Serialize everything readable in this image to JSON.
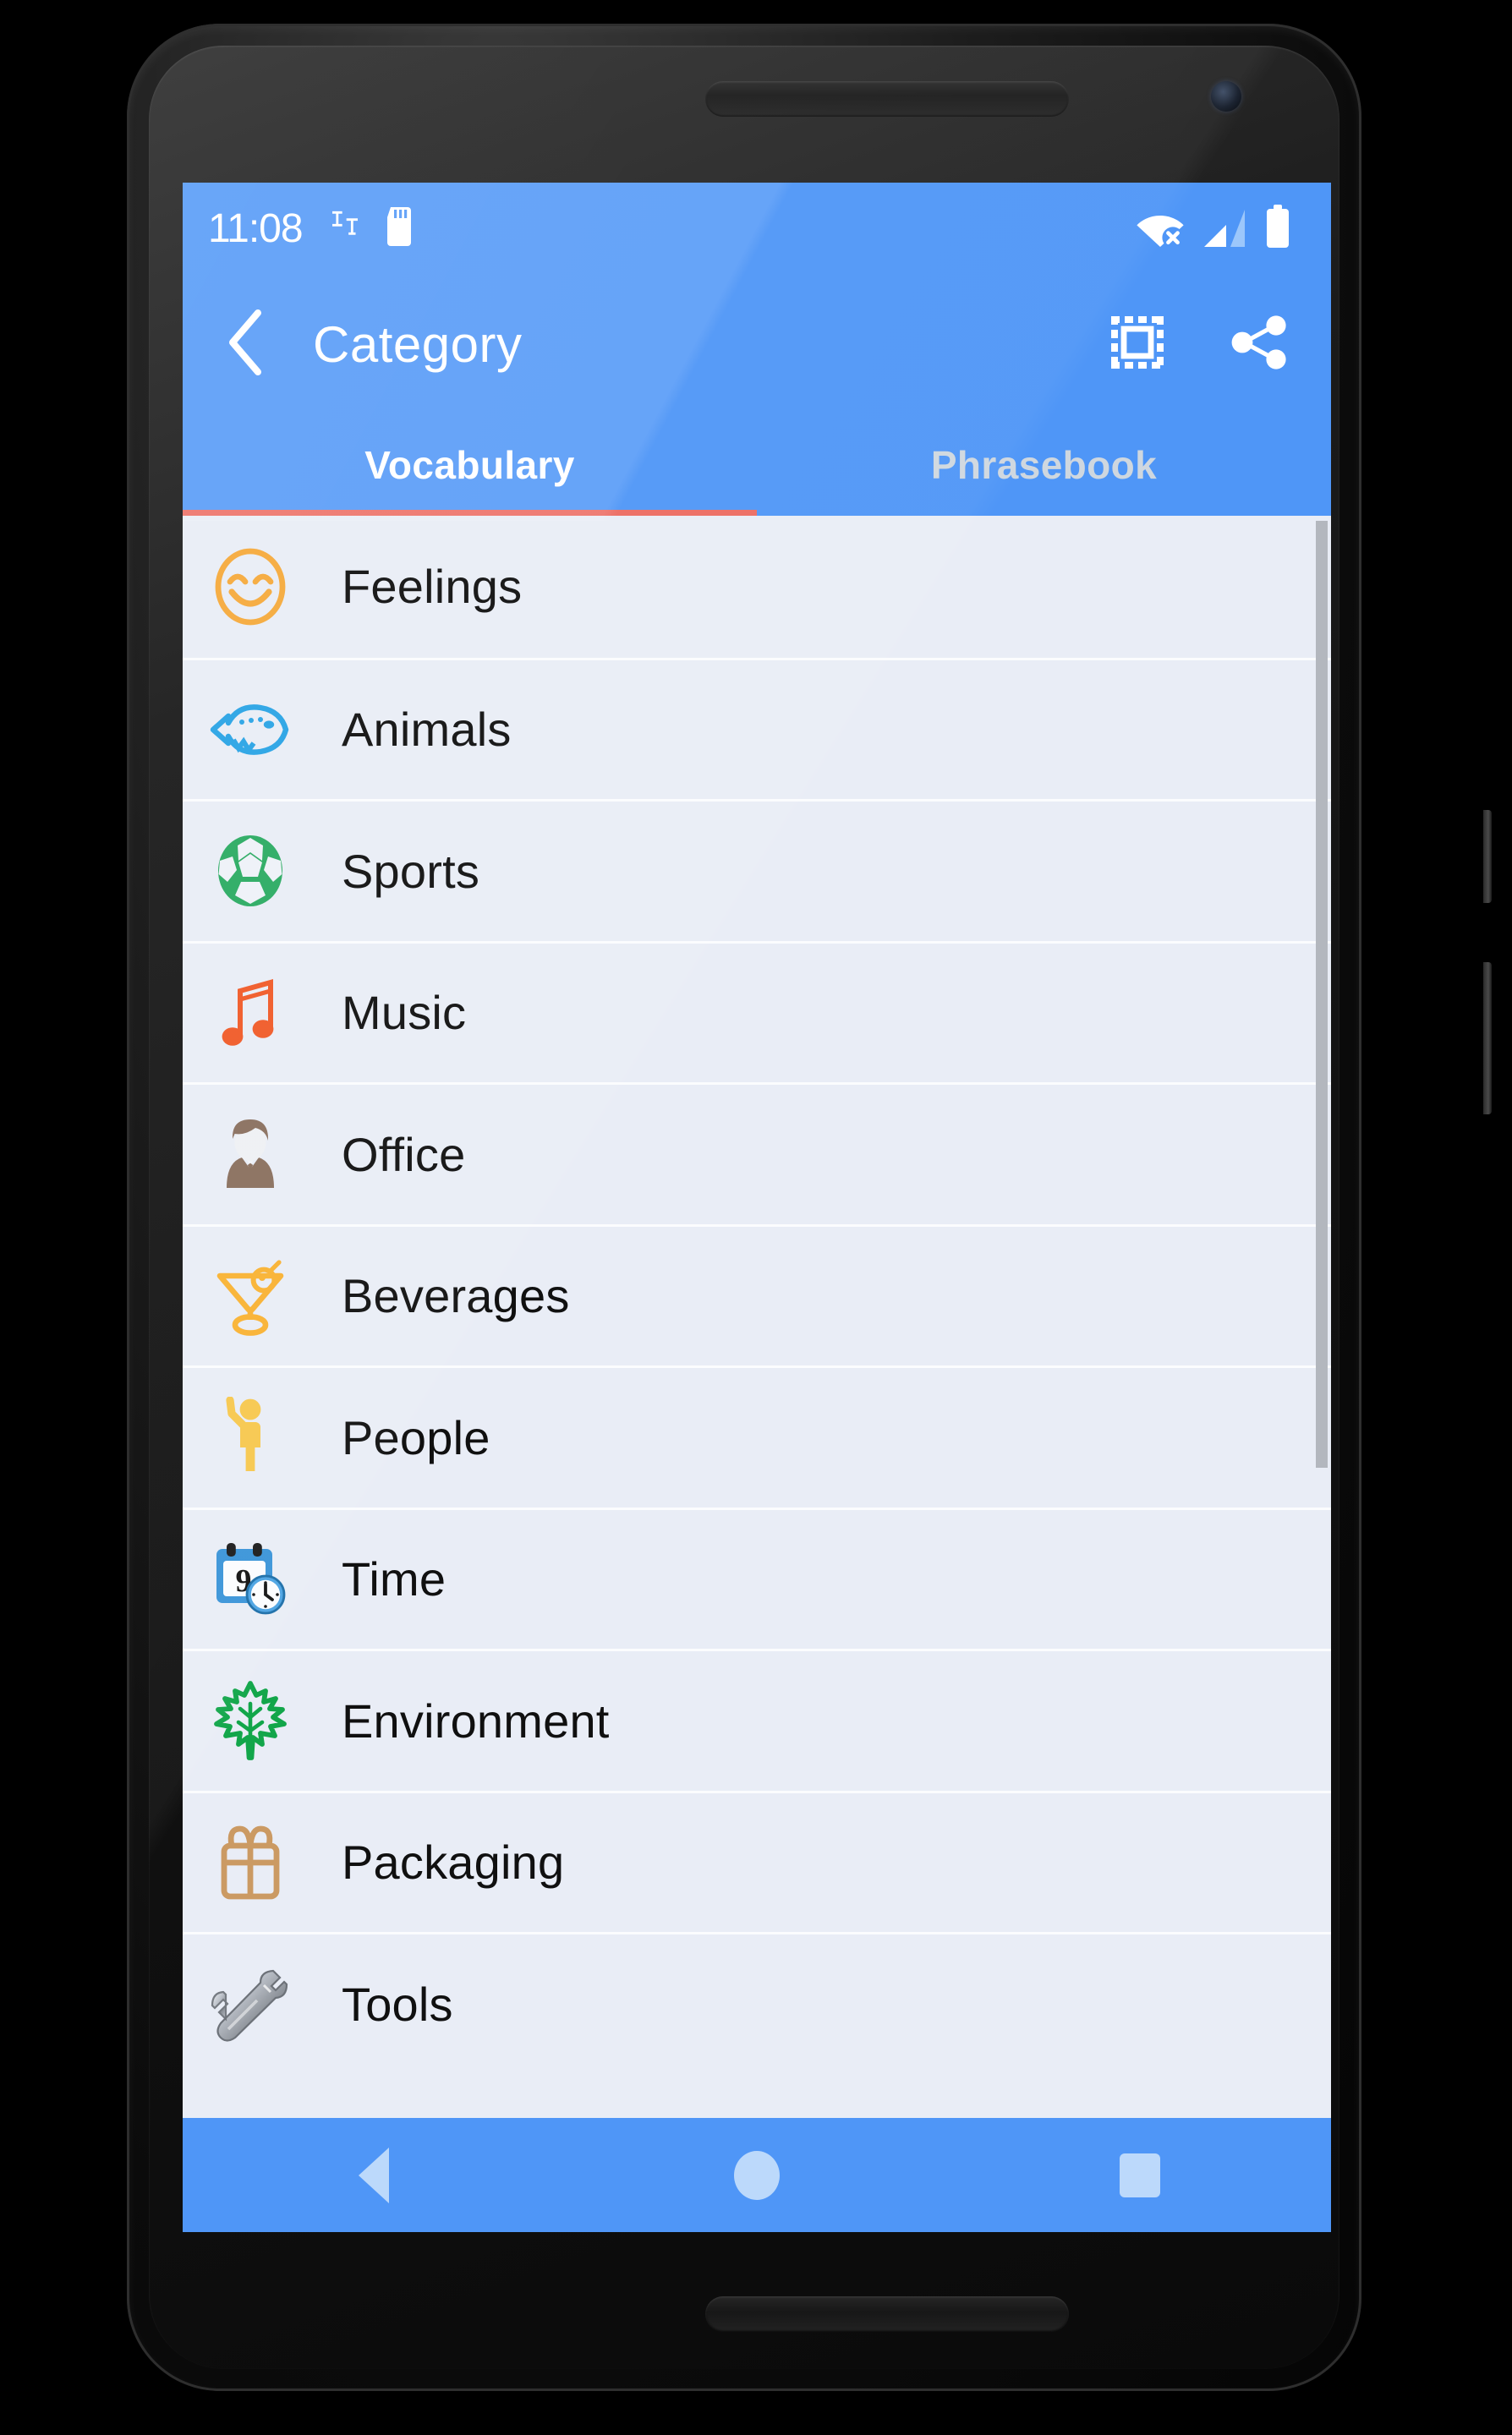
{
  "status_bar": {
    "clock": "11:08",
    "left_icons": [
      "screen-rotation-icon",
      "sd-card-icon"
    ],
    "right_icons": [
      "wifi-off-icon",
      "cellular-signal-icon",
      "battery-full-icon"
    ]
  },
  "app_bar": {
    "back_icon": "chevron-left-icon",
    "title": "Category",
    "actions": [
      {
        "icon": "select-all-icon",
        "name": "select-all-button"
      },
      {
        "icon": "share-icon",
        "name": "share-button"
      }
    ]
  },
  "tabs": {
    "items": [
      {
        "label": "Vocabulary",
        "active": true
      },
      {
        "label": "Phrasebook",
        "active": false
      }
    ],
    "indicator_color": "#ec6b61",
    "active_text_color": "#ffffff",
    "inactive_text_color": "#cfd7df"
  },
  "category_list": {
    "rows": [
      {
        "label": "Feelings",
        "icon": "smiley-face-icon",
        "color": "#f5aa3c"
      },
      {
        "label": "Animals",
        "icon": "fish-icon",
        "color": "#29a3e5"
      },
      {
        "label": "Sports",
        "icon": "soccer-ball-icon",
        "color": "#2bab62"
      },
      {
        "label": "Music",
        "icon": "music-note-icon",
        "color": "#f05a28"
      },
      {
        "label": "Office",
        "icon": "businessman-icon",
        "color": "#8a6f5e"
      },
      {
        "label": "Beverages",
        "icon": "cocktail-glass-icon",
        "color": "#f9b233"
      },
      {
        "label": "People",
        "icon": "person-waving-icon",
        "color": "#f7c84e"
      },
      {
        "label": "Time",
        "icon": "calendar-clock-icon",
        "color": "#3a94d8"
      },
      {
        "label": "Environment",
        "icon": "maple-leaf-icon",
        "color": "#12a64a"
      },
      {
        "label": "Packaging",
        "icon": "gift-box-icon",
        "color": "#cb9a63"
      },
      {
        "label": "Tools",
        "icon": "wrench-icon",
        "color": "#9aa0a6"
      }
    ]
  },
  "nav_bar": {
    "buttons": [
      {
        "name": "nav-back-button",
        "icon": "triangle-back-icon"
      },
      {
        "name": "nav-home-button",
        "icon": "circle-home-icon"
      },
      {
        "name": "nav-recents-button",
        "icon": "square-recents-icon"
      }
    ],
    "color": "#4f96f7",
    "glyph_color": "#bcd9fb"
  },
  "theme": {
    "primary": "#4f96f7",
    "list_background": "#e9edf6",
    "divider": "#fbfcfe",
    "text": "#101010",
    "scrollbar": "#b3b7be"
  }
}
